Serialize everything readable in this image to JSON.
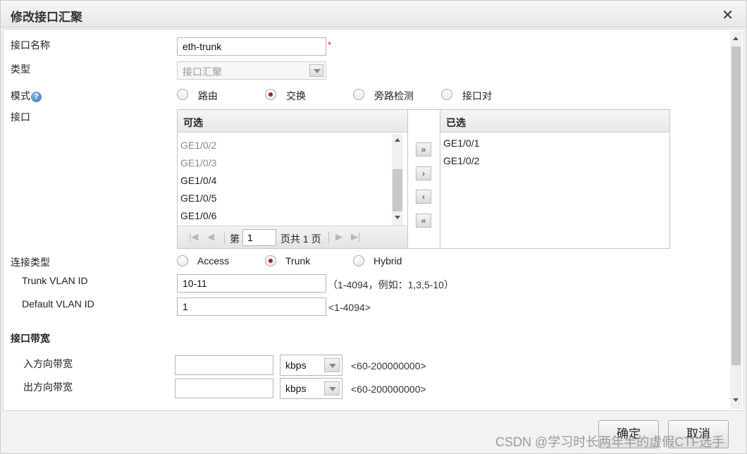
{
  "dialog": {
    "title": "修改接口汇聚",
    "close_glyph": "✕"
  },
  "form": {
    "name_label": "接口名称",
    "name_value": "eth-trunk",
    "required_mark": "*",
    "type_label": "类型",
    "type_value": "接口汇聚",
    "mode_label": "模式",
    "help_glyph": "?",
    "mode_options": [
      "路由",
      "交换",
      "旁路检测",
      "接口对"
    ],
    "mode_selected": "交换",
    "interface_label": "接口"
  },
  "interfaces": {
    "available_header": "可选",
    "available_items": [
      "GE1/0/2",
      "GE1/0/3",
      "GE1/0/4",
      "GE1/0/5",
      "GE1/0/6"
    ],
    "selected_header": "已选",
    "selected_items": [
      "GE1/0/1",
      "GE1/0/2"
    ],
    "pager": {
      "page_prefix": "第",
      "page_value": "1",
      "page_suffix": "页共 1 页"
    },
    "move_buttons": {
      "add_all": "»",
      "add": "›",
      "remove": "‹",
      "remove_all": "«"
    }
  },
  "link": {
    "label": "连接类型",
    "options": [
      "Access",
      "Trunk",
      "Hybrid"
    ],
    "selected": "Trunk",
    "trunk_vlan_label": "Trunk VLAN ID",
    "trunk_vlan_value": "10-11",
    "trunk_vlan_hint": "（1-4094，例如：1,3,5-10）",
    "default_vlan_label": "Default VLAN ID",
    "default_vlan_value": "1",
    "default_vlan_hint": "<1-4094>"
  },
  "bandwidth": {
    "section_title": "接口带宽",
    "in_label": "入方向带宽",
    "in_value": "",
    "in_unit": "kbps",
    "in_hint": "<60-200000000>",
    "out_label": "出方向带宽",
    "out_value": "",
    "out_unit": "kbps",
    "out_hint": "<60-200000000>"
  },
  "footer": {
    "ok_label": "确定",
    "cancel_label": "取消",
    "watermark": "CSDN @学习时长两年半的虚假CTF选手"
  },
  "colors": {
    "radio_dot": "#b21d1d",
    "required": "#e02020",
    "help_icon": "#3c6fc0"
  }
}
